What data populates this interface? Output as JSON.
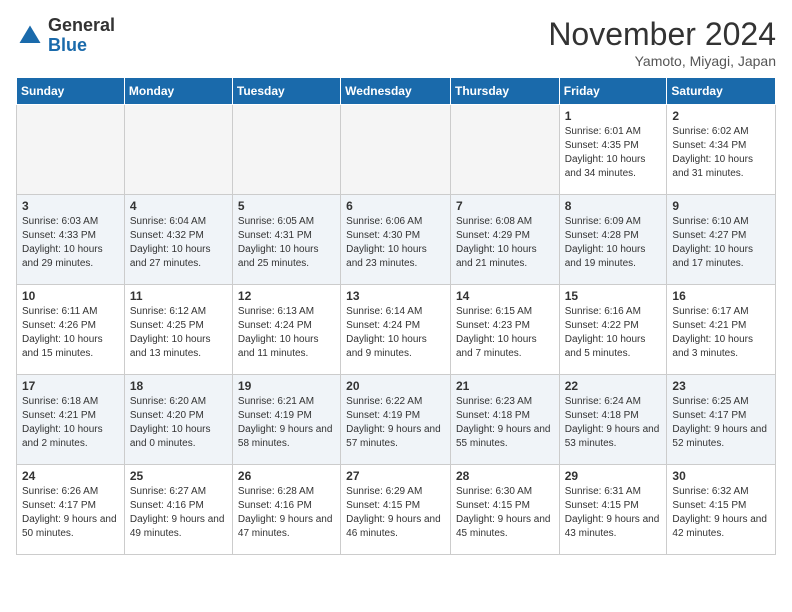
{
  "logo": {
    "general": "General",
    "blue": "Blue"
  },
  "title": "November 2024",
  "location": "Yamoto, Miyagi, Japan",
  "headers": [
    "Sunday",
    "Monday",
    "Tuesday",
    "Wednesday",
    "Thursday",
    "Friday",
    "Saturday"
  ],
  "weeks": [
    [
      {
        "day": "",
        "empty": true
      },
      {
        "day": "",
        "empty": true
      },
      {
        "day": "",
        "empty": true
      },
      {
        "day": "",
        "empty": true
      },
      {
        "day": "",
        "empty": true
      },
      {
        "day": "1",
        "sunrise": "6:01 AM",
        "sunset": "4:35 PM",
        "daylight": "10 hours and 34 minutes."
      },
      {
        "day": "2",
        "sunrise": "6:02 AM",
        "sunset": "4:34 PM",
        "daylight": "10 hours and 31 minutes."
      }
    ],
    [
      {
        "day": "3",
        "sunrise": "6:03 AM",
        "sunset": "4:33 PM",
        "daylight": "10 hours and 29 minutes."
      },
      {
        "day": "4",
        "sunrise": "6:04 AM",
        "sunset": "4:32 PM",
        "daylight": "10 hours and 27 minutes."
      },
      {
        "day": "5",
        "sunrise": "6:05 AM",
        "sunset": "4:31 PM",
        "daylight": "10 hours and 25 minutes."
      },
      {
        "day": "6",
        "sunrise": "6:06 AM",
        "sunset": "4:30 PM",
        "daylight": "10 hours and 23 minutes."
      },
      {
        "day": "7",
        "sunrise": "6:08 AM",
        "sunset": "4:29 PM",
        "daylight": "10 hours and 21 minutes."
      },
      {
        "day": "8",
        "sunrise": "6:09 AM",
        "sunset": "4:28 PM",
        "daylight": "10 hours and 19 minutes."
      },
      {
        "day": "9",
        "sunrise": "6:10 AM",
        "sunset": "4:27 PM",
        "daylight": "10 hours and 17 minutes."
      }
    ],
    [
      {
        "day": "10",
        "sunrise": "6:11 AM",
        "sunset": "4:26 PM",
        "daylight": "10 hours and 15 minutes."
      },
      {
        "day": "11",
        "sunrise": "6:12 AM",
        "sunset": "4:25 PM",
        "daylight": "10 hours and 13 minutes."
      },
      {
        "day": "12",
        "sunrise": "6:13 AM",
        "sunset": "4:24 PM",
        "daylight": "10 hours and 11 minutes."
      },
      {
        "day": "13",
        "sunrise": "6:14 AM",
        "sunset": "4:24 PM",
        "daylight": "10 hours and 9 minutes."
      },
      {
        "day": "14",
        "sunrise": "6:15 AM",
        "sunset": "4:23 PM",
        "daylight": "10 hours and 7 minutes."
      },
      {
        "day": "15",
        "sunrise": "6:16 AM",
        "sunset": "4:22 PM",
        "daylight": "10 hours and 5 minutes."
      },
      {
        "day": "16",
        "sunrise": "6:17 AM",
        "sunset": "4:21 PM",
        "daylight": "10 hours and 3 minutes."
      }
    ],
    [
      {
        "day": "17",
        "sunrise": "6:18 AM",
        "sunset": "4:21 PM",
        "daylight": "10 hours and 2 minutes."
      },
      {
        "day": "18",
        "sunrise": "6:20 AM",
        "sunset": "4:20 PM",
        "daylight": "10 hours and 0 minutes."
      },
      {
        "day": "19",
        "sunrise": "6:21 AM",
        "sunset": "4:19 PM",
        "daylight": "9 hours and 58 minutes."
      },
      {
        "day": "20",
        "sunrise": "6:22 AM",
        "sunset": "4:19 PM",
        "daylight": "9 hours and 57 minutes."
      },
      {
        "day": "21",
        "sunrise": "6:23 AM",
        "sunset": "4:18 PM",
        "daylight": "9 hours and 55 minutes."
      },
      {
        "day": "22",
        "sunrise": "6:24 AM",
        "sunset": "4:18 PM",
        "daylight": "9 hours and 53 minutes."
      },
      {
        "day": "23",
        "sunrise": "6:25 AM",
        "sunset": "4:17 PM",
        "daylight": "9 hours and 52 minutes."
      }
    ],
    [
      {
        "day": "24",
        "sunrise": "6:26 AM",
        "sunset": "4:17 PM",
        "daylight": "9 hours and 50 minutes."
      },
      {
        "day": "25",
        "sunrise": "6:27 AM",
        "sunset": "4:16 PM",
        "daylight": "9 hours and 49 minutes."
      },
      {
        "day": "26",
        "sunrise": "6:28 AM",
        "sunset": "4:16 PM",
        "daylight": "9 hours and 47 minutes."
      },
      {
        "day": "27",
        "sunrise": "6:29 AM",
        "sunset": "4:15 PM",
        "daylight": "9 hours and 46 minutes."
      },
      {
        "day": "28",
        "sunrise": "6:30 AM",
        "sunset": "4:15 PM",
        "daylight": "9 hours and 45 minutes."
      },
      {
        "day": "29",
        "sunrise": "6:31 AM",
        "sunset": "4:15 PM",
        "daylight": "9 hours and 43 minutes."
      },
      {
        "day": "30",
        "sunrise": "6:32 AM",
        "sunset": "4:15 PM",
        "daylight": "9 hours and 42 minutes."
      }
    ]
  ]
}
